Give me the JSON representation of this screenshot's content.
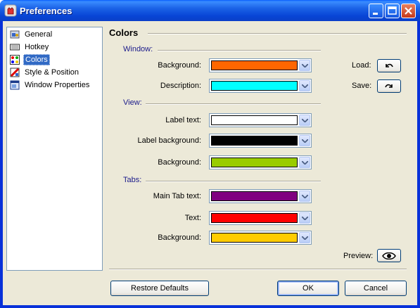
{
  "window": {
    "title": "Preferences"
  },
  "tree": {
    "items": [
      {
        "label": "General",
        "icon": "general-icon",
        "selected": false
      },
      {
        "label": "Hotkey",
        "icon": "keyboard-icon",
        "selected": false
      },
      {
        "label": "Colors",
        "icon": "colors-icon",
        "selected": true
      },
      {
        "label": "Style & Position",
        "icon": "style-icon",
        "selected": false
      },
      {
        "label": "Window Properties",
        "icon": "window-properties-icon",
        "selected": false
      }
    ]
  },
  "panel": {
    "title": "Colors",
    "groups": {
      "window": "Window:",
      "view": "View:",
      "tabs": "Tabs:"
    },
    "rows": [
      {
        "label": "Background:",
        "color": "#ff6600"
      },
      {
        "label": "Description:",
        "color": "#00ffff"
      },
      {
        "label": "Label text:",
        "color": "#ffffff"
      },
      {
        "label": "Label  background:",
        "color": "#000000"
      },
      {
        "label": "Background:",
        "color": "#99cc00"
      },
      {
        "label": "Main Tab text:",
        "color": "#800080"
      },
      {
        "label": "Text:",
        "color": "#ff0000"
      },
      {
        "label": "Background:",
        "color": "#ffcc00"
      }
    ],
    "load_label": "Load:",
    "save_label": "Save:",
    "preview_label": "Preview:"
  },
  "footer": {
    "restore_label": "Restore Defaults",
    "ok_label": "OK",
    "cancel_label": "Cancel"
  }
}
